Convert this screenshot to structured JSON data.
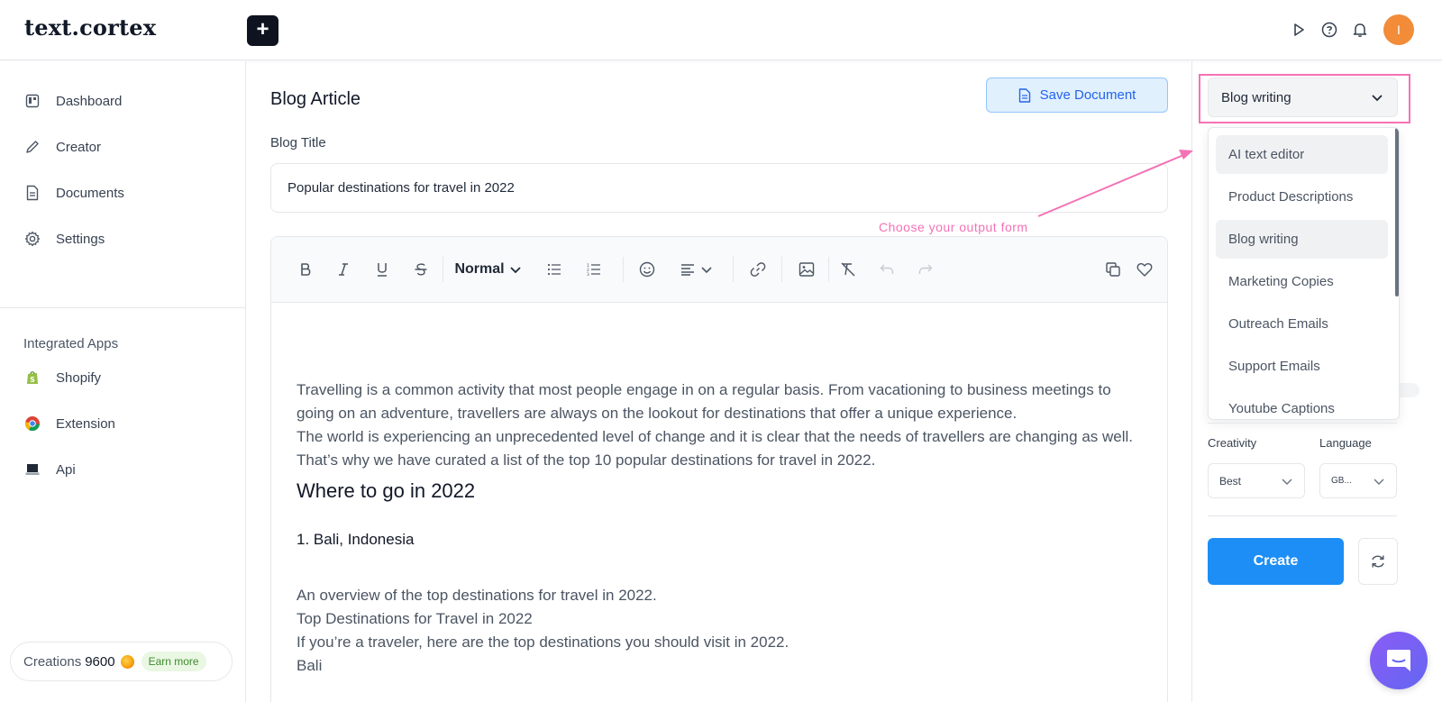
{
  "app": {
    "logo_text": "text.cortex",
    "new_button_label": "+",
    "avatar_initial": "I"
  },
  "sidebar": {
    "items": [
      {
        "label": "Dashboard",
        "icon": "dashboard-icon"
      },
      {
        "label": "Creator",
        "icon": "pencil-icon"
      },
      {
        "label": "Documents",
        "icon": "document-icon"
      },
      {
        "label": "Settings",
        "icon": "gear-icon"
      }
    ],
    "integrated_heading": "Integrated Apps",
    "apps": [
      {
        "label": "Shopify",
        "icon": "shopify-icon"
      },
      {
        "label": "Extension",
        "icon": "chrome-icon"
      },
      {
        "label": "Api",
        "icon": "terminal-icon"
      }
    ],
    "credits_label": "Creations",
    "credits_value": "9600",
    "earn_more_label": "Earn more"
  },
  "main": {
    "doc_title": "Blog Article",
    "save_label": "Save Document",
    "blog_title_label": "Blog Title",
    "blog_title_value": "Popular destinations for travel in 2022",
    "toolbar": {
      "heading_select": "Normal"
    },
    "content": {
      "p1": "Travelling is a common activity that most people engage in on a regular basis. From vacationing to business meetings to going on an adventure, travellers are always on the lookout for destinations that offer a unique experience.",
      "p2": "The world is experiencing an unprecedented level of change and it is clear that the needs of travellers are changing as well. That’s why we have curated a list of the top 10 popular destinations for travel in 2022.",
      "h2": "Where to go in 2022",
      "h3": "1. Bali, Indonesia",
      "p3": "An overview of the top destinations for travel in 2022.",
      "p4": "Top Destinations for Travel in 2022",
      "p5": "If you’re a traveler, here are the top destinations you should visit in 2022.",
      "p6": "Bali"
    }
  },
  "right_panel": {
    "selected_type": "Blog writing",
    "options": [
      {
        "label": "AI text editor",
        "active": true
      },
      {
        "label": "Product Descriptions",
        "active": false
      },
      {
        "label": "Blog writing",
        "active": true
      },
      {
        "label": "Marketing Copies",
        "active": false
      },
      {
        "label": "Outreach Emails",
        "active": false
      },
      {
        "label": "Support Emails",
        "active": false
      },
      {
        "label": "Youtube Captions",
        "active": false
      }
    ],
    "hint": "Choose your output form",
    "creativity_label": "Creativity",
    "creativity_value": "Best",
    "language_label": "Language",
    "language_value": "GB...",
    "create_label": "Create"
  },
  "colors": {
    "accent": "#1d8ef5",
    "highlight": "#f472b6",
    "avatar": "#f28c38"
  }
}
